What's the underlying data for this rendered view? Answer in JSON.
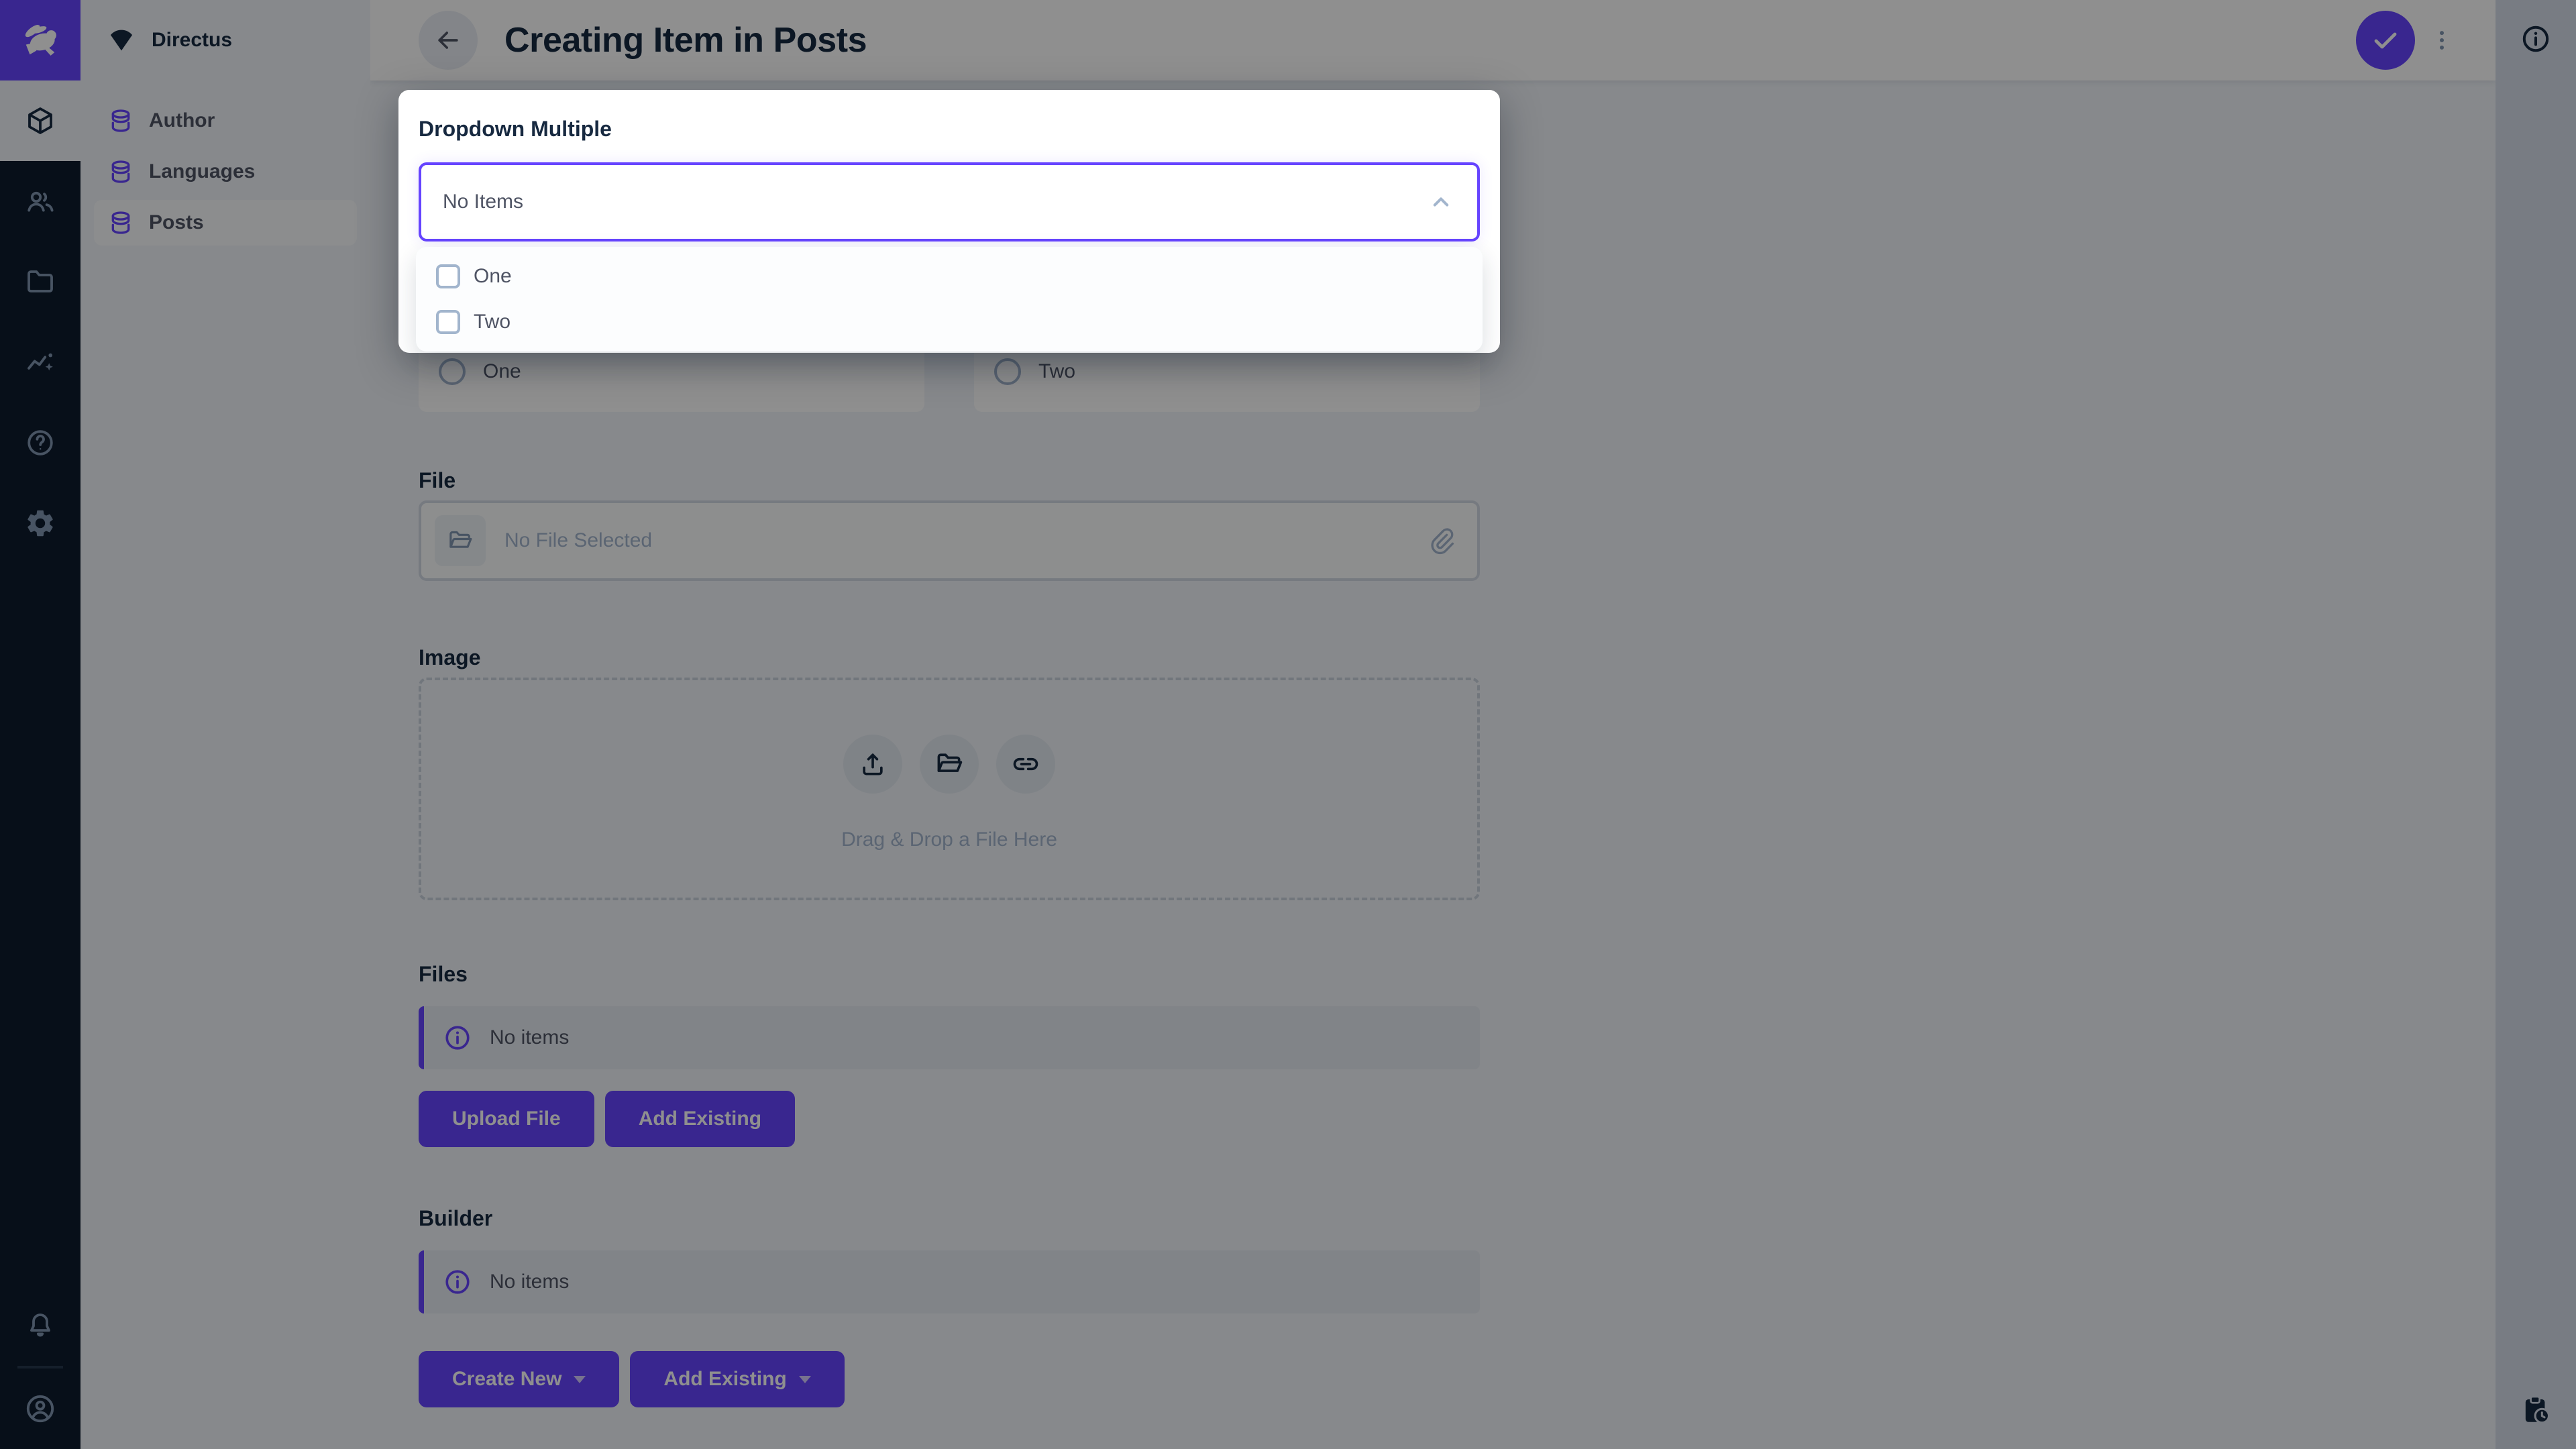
{
  "header": {
    "title": "Creating Item in Posts"
  },
  "nav": {
    "project": "Directus",
    "items": [
      {
        "label": "Author",
        "active": false
      },
      {
        "label": "Languages",
        "active": false
      },
      {
        "label": "Posts",
        "active": true
      }
    ]
  },
  "module_bar": {
    "modules": [
      {
        "name": "content",
        "icon": "box-icon",
        "active": true
      },
      {
        "name": "user-directory",
        "icon": "people-icon",
        "active": false
      },
      {
        "name": "file-library",
        "icon": "folder-icon",
        "active": false
      },
      {
        "name": "insights",
        "icon": "chart-sparkle-icon",
        "active": false
      },
      {
        "name": "documentation",
        "icon": "help-icon",
        "active": false
      },
      {
        "name": "settings",
        "icon": "gear-icon",
        "active": false
      }
    ],
    "bottom": [
      {
        "name": "notifications",
        "icon": "bell-icon"
      },
      {
        "name": "account",
        "icon": "person-circle-icon"
      }
    ]
  },
  "popover": {
    "label": "Dropdown Multiple",
    "value": "No Items",
    "options": [
      {
        "label": "One",
        "checked": false
      },
      {
        "label": "Two",
        "checked": false
      }
    ]
  },
  "form": {
    "radio_options": [
      "One",
      "Two"
    ],
    "file": {
      "label": "File",
      "placeholder": "No File Selected"
    },
    "image": {
      "label": "Image",
      "caption": "Drag & Drop a File Here"
    },
    "files": {
      "label": "Files",
      "notice": "No items",
      "buttons": [
        "Upload File",
        "Add Existing"
      ]
    },
    "builder": {
      "label": "Builder",
      "notice": "No items",
      "buttons": [
        "Create New",
        "Add Existing"
      ]
    }
  },
  "colors": {
    "accent": "#6644ff",
    "module_bg": "#0e1c2e",
    "nav_bg": "#f0f4f9",
    "content_bg": "#f0f4f9",
    "header_bg": "#ffffff",
    "rail_bg": "#d6dee9",
    "notice_bg": "#e7ecf3",
    "border": "#d3dae4",
    "label_text": "#172940",
    "body_text": "#4f5464",
    "muted_text": "#a2b5cd",
    "module_icon": "#8196b1",
    "scrim": "rgba(0,0,0,0.44)"
  }
}
